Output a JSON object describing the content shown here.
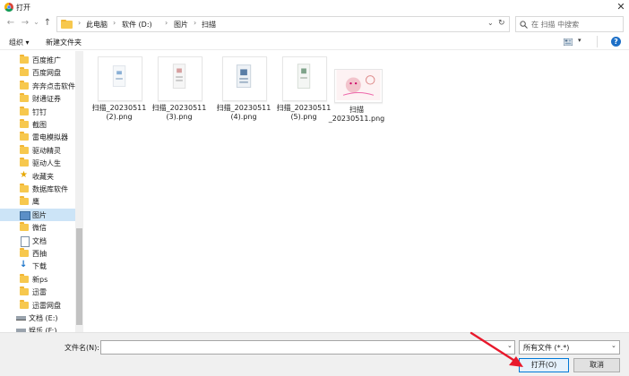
{
  "window": {
    "title": "打开",
    "close_glyph": "✕"
  },
  "nav": {
    "back": "←",
    "forward": "→",
    "dropdown": "⌄",
    "up": "↑",
    "breadcrumbs": [
      "此电脑",
      "软件 (D:)",
      "图片",
      "扫描"
    ],
    "refresh": "↻",
    "search_placeholder": "在 扫描 中搜索"
  },
  "toolbar": {
    "organize": "组织 ▾",
    "new_folder": "新建文件夹",
    "help": "?"
  },
  "sidebar": {
    "items": [
      {
        "label": "百度推广",
        "icon": "folder-icon"
      },
      {
        "label": "百度网盘",
        "icon": "folder-icon"
      },
      {
        "label": "奔奔点击软件",
        "icon": "folder-icon"
      },
      {
        "label": "财通证券",
        "icon": "folder-icon"
      },
      {
        "label": "钉钉",
        "icon": "folder-icon"
      },
      {
        "label": "截图",
        "icon": "folder-icon"
      },
      {
        "label": "雷电模拟器",
        "icon": "folder-icon"
      },
      {
        "label": "驱动精灵",
        "icon": "folder-icon"
      },
      {
        "label": "驱动人生",
        "icon": "folder-icon"
      },
      {
        "label": "收藏夹",
        "icon": "star-icon"
      },
      {
        "label": "数据库软件",
        "icon": "folder-icon"
      },
      {
        "label": "鹰",
        "icon": "folder-icon"
      },
      {
        "label": "图片",
        "icon": "pictures-icon"
      },
      {
        "label": "微信",
        "icon": "folder-icon"
      },
      {
        "label": "文档",
        "icon": "document-icon"
      },
      {
        "label": "西抽",
        "icon": "folder-icon"
      },
      {
        "label": "下载",
        "icon": "download-icon"
      },
      {
        "label": "新ps",
        "icon": "folder-icon"
      },
      {
        "label": "迅雷",
        "icon": "folder-icon"
      },
      {
        "label": "迅雷网盘",
        "icon": "folder-icon"
      },
      {
        "label": "文档 (E:)",
        "icon": "drive-icon"
      },
      {
        "label": "娱乐 (F:)",
        "icon": "drive-icon"
      }
    ]
  },
  "files": [
    {
      "name": "扫描_20230511\n(2).png"
    },
    {
      "name": "扫描_20230511\n(3).png"
    },
    {
      "name": "扫描_20230511\n(4).png"
    },
    {
      "name": "扫描_20230511\n(5).png"
    },
    {
      "name": "扫描\n_20230511.png"
    }
  ],
  "footer": {
    "filename_label": "文件名(N):",
    "filename_value": "",
    "filter_value": "所有文件 (*.*)",
    "open_label": "打开(O)",
    "cancel_label": "取消"
  },
  "colors": {
    "accent": "#0078d7",
    "folder": "#f7c84e",
    "arrow": "#e8192c"
  }
}
